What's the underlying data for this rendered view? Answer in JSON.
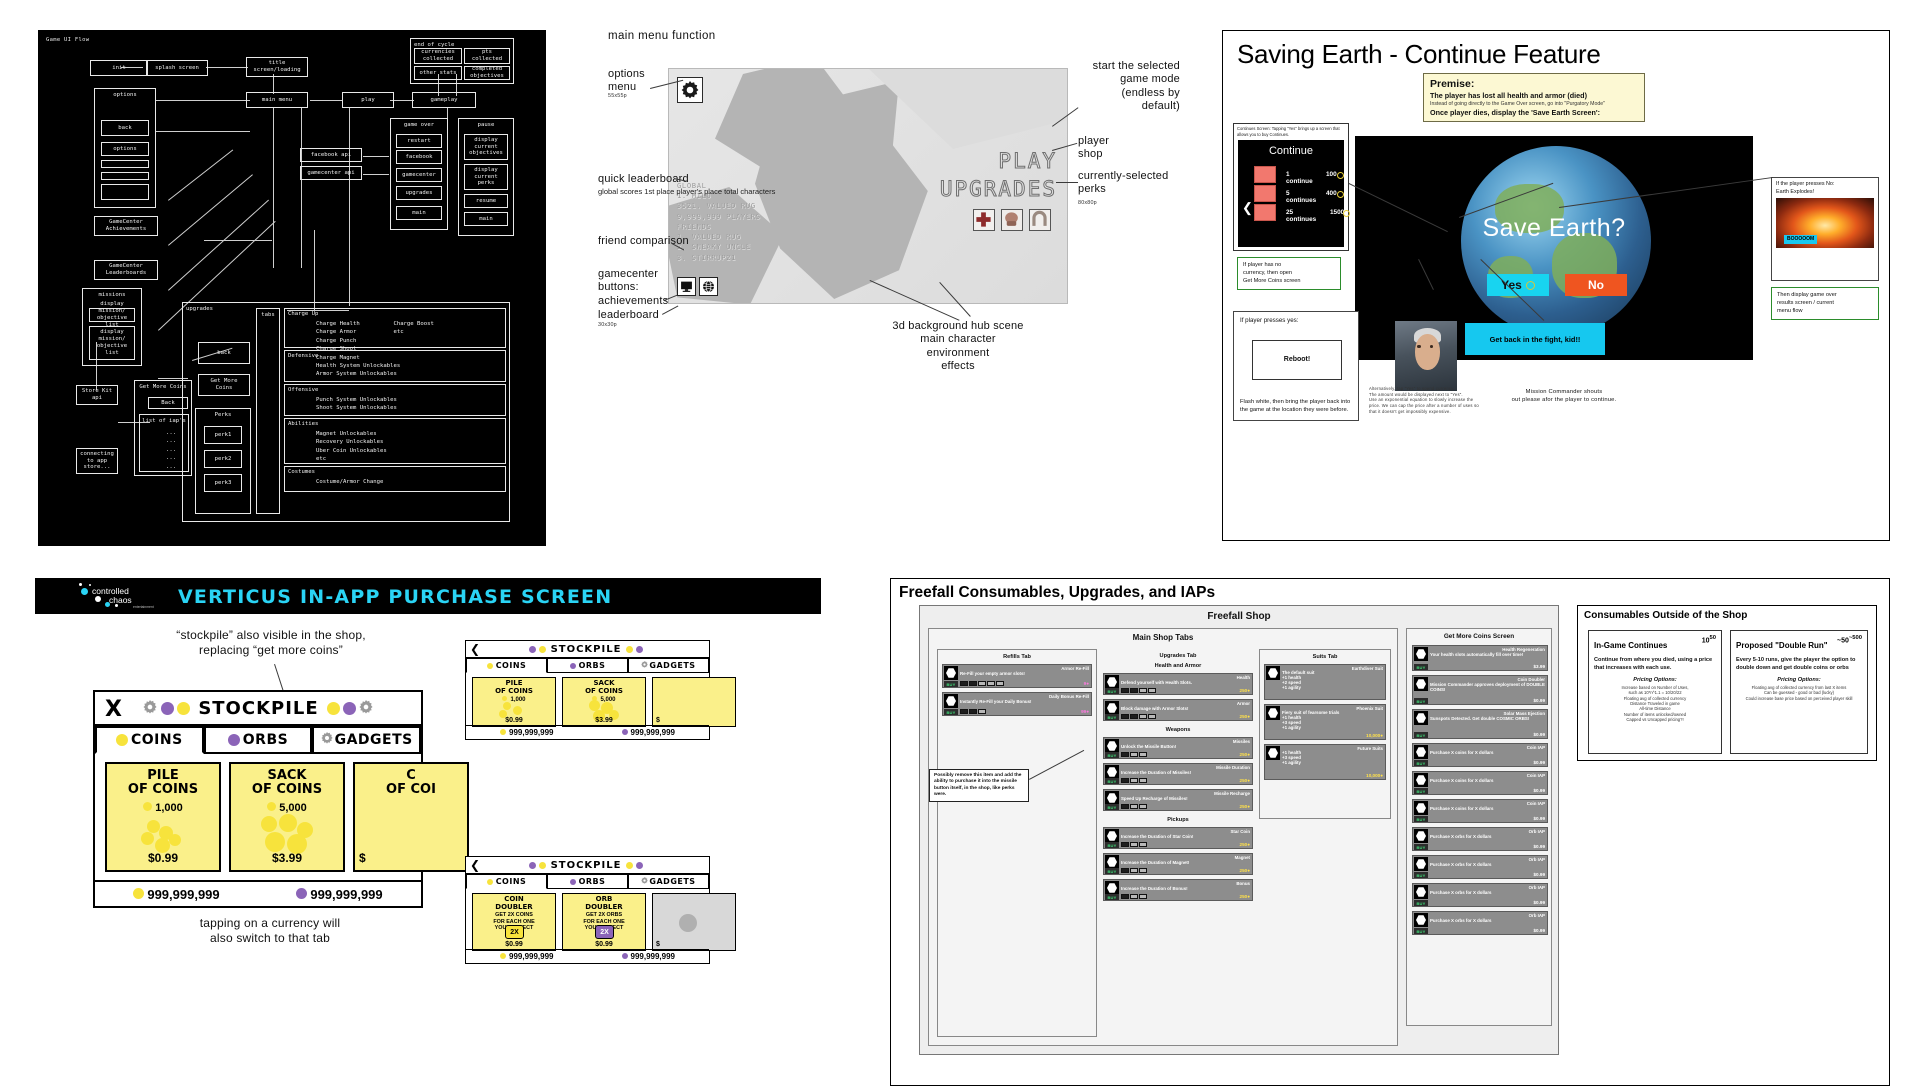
{
  "ui_flow": {
    "title": "Game UI Flow",
    "nodes": [
      {
        "label": "init"
      },
      {
        "label": "splash screen"
      },
      {
        "label": "title\nscreen/loading"
      },
      {
        "label": "main menu"
      },
      {
        "label": "play"
      },
      {
        "label": "gameplay"
      },
      {
        "label": "options"
      },
      {
        "label": "back"
      },
      {
        "label": "options"
      },
      {
        "label": "GameCenter\nAchievements"
      },
      {
        "label": "GameCenter\nLeaderboards"
      },
      {
        "label": "missions"
      },
      {
        "label": "display\nmission/\nobjective\nlist"
      },
      {
        "label": "Store Kit\napi"
      },
      {
        "label": "connecting\nto app\nstore..."
      },
      {
        "label": "Get More Coins"
      },
      {
        "label": "Back"
      },
      {
        "label": "list of iap's"
      },
      {
        "label": "facebook api"
      },
      {
        "label": "gamecenter api"
      },
      {
        "label": "game over"
      },
      {
        "label": "restart"
      },
      {
        "label": "facebook"
      },
      {
        "label": "gamecenter"
      },
      {
        "label": "upgrades"
      },
      {
        "label": "main"
      },
      {
        "label": "pause"
      },
      {
        "label": "display\ncurrent\nobjectives"
      },
      {
        "label": "display\ncurrent\nperks"
      },
      {
        "label": "resume"
      },
      {
        "label": "main"
      },
      {
        "label": "end of cycle"
      },
      {
        "label": "currencies\ncollected"
      },
      {
        "label": "pts\ncollected"
      },
      {
        "label": "other stats"
      },
      {
        "label": "completed\nobjectives"
      },
      {
        "label": "upgrades"
      },
      {
        "label": "back"
      },
      {
        "label": "Get More Coins"
      },
      {
        "label": "Perks"
      },
      {
        "label": "perk1"
      },
      {
        "label": "perk2"
      },
      {
        "label": "perk3"
      },
      {
        "label": "tabs"
      }
    ],
    "upgrade_sections": [
      {
        "heading": "Charge Up",
        "items": [
          "Charge Health          Charge Boost",
          "Charge Armor           etc",
          "Charge Punch",
          "Charge Shoot",
          "Charge Magnet"
        ]
      },
      {
        "heading": "Defensive",
        "items": [
          "Health System Unlockables",
          "Armor System Unlockables"
        ]
      },
      {
        "heading": "Offensive",
        "items": [
          "Punch System Unlockables",
          "Shoot System Unlockables"
        ]
      },
      {
        "heading": "Abilities",
        "items": [
          "Magnet Unlockables",
          "Recovery Unlockables",
          "Uber Coin Unlockables",
          "etc"
        ]
      },
      {
        "heading": "Costumes",
        "items": [
          "Costume/Armor Change"
        ]
      }
    ]
  },
  "main_menu": {
    "heading": "main menu function",
    "annotations": {
      "options_menu": "options\nmenu",
      "options_menu_size": "55x55p",
      "quick_leaderboard": "quick leaderboard",
      "quick_leaderboard_details": [
        "global scores",
        "1st place",
        "player's place",
        "total characters"
      ],
      "friend_comparison": "friend comparison",
      "gamecenter_buttons": "gamecenter\nbuttons:",
      "achievements": "achievements",
      "leaderboard": "leaderboard",
      "gc_size": "30x30p",
      "start_mode": "start the selected\ngame mode\n(endless by\ndefault)",
      "player_shop": "player shop",
      "selected_perks": "currently-selected\nperks",
      "perks_size": "80x80p",
      "background_note": "3d background hub scene\nmain character\nenvironment\neffects"
    },
    "leaderboard_lines": [
      "GLOBAL",
      "1. MILO",
      "3521. VALUED RUG",
      "9,999,999 PLAYERS",
      "FRIENDS",
      "1. VALUED RUG",
      "2. SNEAKY UNCLE",
      "3. STIRRUP21"
    ],
    "big_words": [
      "PLAY",
      "UPGRADES"
    ],
    "perk_icons": [
      "health-cross-icon",
      "boxing-glove-icon",
      "magnet-icon"
    ]
  },
  "saving_earth": {
    "title": "Saving Earth - Continue Feature",
    "premise": {
      "heading": "Premise:",
      "line1": "The player has lost all health and armor (died)",
      "line2": "Instead of going directly to the Game Over screen, go into \"Purgatory Mode\"",
      "line3": "Once player dies, display the 'Save Earth Screen':"
    },
    "continue_caption": "Continues Screen: Tapping \"Yes\" brings up a screen that allows you to buy Continues.",
    "continue_title": "Continue",
    "continue_options": [
      {
        "label": "1 continue",
        "price": "100"
      },
      {
        "label": "5 continues",
        "price": "400"
      },
      {
        "label": "25 continues",
        "price": "1500"
      }
    ],
    "no_currency_note": "If player has no\ncurrency, then open\nGet More Coins screen",
    "save_prompt": "Save Earth?",
    "yes_label": "Yes",
    "no_label": "No",
    "yes_note": "If player presses yes:",
    "yes_body": "Flash white, then bring the player back into the game at the location they were before.",
    "reboot_label": "Reboot!",
    "no_note": "If the player presses No:\nEarth Explodes!",
    "boom_label": "BOOOOOM",
    "game_over_note": "Then display game over\nresults screen / current\nmenu flow",
    "cyan_msg": "Get back in the fight, kid!!",
    "commander_note": "Mission Commander shouts\nout please afor the player to continue.",
    "currency_note": "Alternatively, tap \"Yes\" to spend currency.\nThe amount would be displayed next to \"Yes\".\nUse an exponential equation to slowly increase the price. We can cap the price after a number of uses so that it doesn't get impossibly expensive."
  },
  "iap": {
    "banner_title": "VERTICUS IN-APP PURCHASE SCREEN",
    "logo": {
      "line1": "controlled",
      "line2": "chaos",
      "line3": "entertainment"
    },
    "note_top": "“stockpile” also visible in the shop,\nreplacing “get more coins”",
    "note_bottom": "tapping on a currency will\nalso switch to that tab",
    "main_screen": {
      "close_label": "X",
      "title": "STOCKPILE",
      "tabs": [
        "COINS",
        "ORBS",
        "GADGETS"
      ],
      "active_tab": "COINS",
      "cards": [
        {
          "name": "PILE\nOF COINS",
          "qty": "1,000",
          "price": "$0.99"
        },
        {
          "name": "SACK\nOF COINS",
          "qty": "5,000",
          "price": "$3.99"
        },
        {
          "name": "C\nOF COI",
          "qty": "",
          "price": "$"
        }
      ],
      "footer": [
        {
          "value": "999,999,999",
          "type": "coin"
        },
        {
          "value": "999,999,999",
          "type": "orb"
        }
      ]
    },
    "small_screen_1": {
      "title": "STOCKPILE",
      "tabs": [
        "COINS",
        "ORBS",
        "GADGETS"
      ],
      "cards": [
        {
          "name": "PILE\nOF COINS",
          "qty": "1,000",
          "price": "$0.99"
        },
        {
          "name": "SACK\nOF COINS",
          "qty": "5,000",
          "price": "$3.99"
        },
        {
          "name": "",
          "qty": "",
          "price": "$"
        }
      ],
      "footer": [
        {
          "value": "999,999,999",
          "type": "coin"
        },
        {
          "value": "999,999,999",
          "type": "orb"
        }
      ]
    },
    "small_screen_2": {
      "title": "STOCKPILE",
      "tabs": [
        "COINS",
        "ORBS",
        "GADGETS"
      ],
      "cards": [
        {
          "name": "COIN\nDOUBLER",
          "desc": "GET 2X COINS\nFOR EACH ONE\nYOU COLLECT",
          "badge": "2X",
          "price": "$0.99"
        },
        {
          "name": "ORB\nDOUBLER",
          "desc": "GET 2X ORBS\nFOR EACH ONE\nYOU COLLECT",
          "badge": "2X",
          "price": "$0.99"
        },
        {
          "name": "",
          "desc": "",
          "badge": "",
          "price": "$"
        }
      ],
      "footer": [
        {
          "value": "999,999,999",
          "type": "coin"
        },
        {
          "value": "999,999,999",
          "type": "orb"
        }
      ]
    }
  },
  "freefall": {
    "title": "Freefall Consumables, Upgrades, and IAPs",
    "shop_title": "Freefall Shop",
    "main_tabs_label": "Main Shop Tabs",
    "columns": [
      {
        "label": "Refills Tab",
        "items": [
          {
            "name": "Armor Re-Fill",
            "desc": "Re-Fill your empty armor slots!",
            "price": "9",
            "currency": "orb",
            "pips": 5,
            "on": 2
          },
          {
            "name": "Daily Bonus Re-Fill",
            "desc": "Instantly Re-Fill your Daily Bonus!",
            "price": "99",
            "currency": "orb",
            "pips": 3,
            "on": 1
          }
        ]
      },
      {
        "label": "Upgrades Tab",
        "groups": [
          {
            "heading": "Health and Armor",
            "items": [
              {
                "name": "Health",
                "desc": "Defend yourself with Health Slots.",
                "price": "250",
                "currency": "coin"
              },
              {
                "name": "Armor",
                "desc": "Block damage with Armor Slots!",
                "price": "250",
                "currency": "coin"
              }
            ]
          },
          {
            "heading": "Weapons",
            "items": [
              {
                "name": "Missiles",
                "desc": "Unlock the Missile Button!",
                "price": "250",
                "currency": "coin"
              },
              {
                "name": "Missile Duration",
                "desc": "Increase the Duration of Missiles!",
                "price": "250",
                "currency": "coin"
              },
              {
                "name": "Missile Recharge",
                "desc": "Speed Up Recharge of Missiles!",
                "price": "250",
                "currency": "coin"
              }
            ]
          },
          {
            "heading": "Pickups",
            "items": [
              {
                "name": "Star Coin",
                "desc": "Increase the Duration of Star Coin!",
                "price": "250",
                "currency": "coin"
              },
              {
                "name": "Magnet",
                "desc": "Increase the Duration of Magnet!",
                "price": "250",
                "currency": "coin"
              },
              {
                "name": "Bonus",
                "desc": "Increase the Duration of Bonus!",
                "price": "250",
                "currency": "coin"
              }
            ]
          }
        ]
      },
      {
        "label": "Suits Tab",
        "items": [
          {
            "name": "Earthdiver Suit",
            "desc": "The default suit\n+1 health\n+2 speed\n+1 agility",
            "price": "",
            "currency": ""
          },
          {
            "name": "Phoenix Suit",
            "desc": "Fiery suit of fearsome trials\n+1 health\n+3 speed\n+1 agility",
            "price": "10,000",
            "currency": "coin"
          },
          {
            "name": "Future Suits",
            "desc": "+1 health\n+3 speed\n+1 agility",
            "price": "10,000",
            "currency": "coin"
          }
        ]
      }
    ],
    "get_more_coins": {
      "label": "Get More Coins Screen",
      "items": [
        {
          "name": "Health Regeneration",
          "desc": "Your health slots automatically fill over time!",
          "price": "$3.99"
        },
        {
          "name": "Coin Doubler",
          "desc": "Mission Commander approves deployment of DOUBLE COINS!",
          "price": "$0.99"
        },
        {
          "name": "Solar Mass Ejection",
          "desc": "Sunspots Detected. Get double COSMIC ORBS!",
          "price": "$0.99"
        },
        {
          "name": "Coin IAP",
          "desc": "Purchase X coins for X dollars",
          "price": "$0.99"
        },
        {
          "name": "Coin IAP",
          "desc": "Purchase X coins for X dollars",
          "price": "$0.99"
        },
        {
          "name": "Coin IAP",
          "desc": "Purchase X coins for X dollars",
          "price": "$0.99"
        },
        {
          "name": "Orb IAP",
          "desc": "Purchase X orbs for X dollars",
          "price": "$0.99"
        },
        {
          "name": "Orb IAP",
          "desc": "Purchase X orbs for X dollars",
          "price": "$0.99"
        },
        {
          "name": "Orb IAP",
          "desc": "Purchase X orbs for X dollars",
          "price": "$0.99"
        },
        {
          "name": "Orb IAP",
          "desc": "Purchase X orbs for X dollars",
          "price": "$0.99"
        }
      ]
    },
    "outside_shop": {
      "title": "Consumables Outside of the Shop",
      "cards": [
        {
          "heading": "In-Game Continues",
          "price": "10",
          "price_sup": "50",
          "desc": "Continue from where you died, using a price that increases with each use.",
          "pricing_heading": "Pricing Options:",
          "pricing": "Increase based on Number of Uses,\nsuch as 10*n^1.1 = 10/20/22\nFloating avg of collected currency\nDistance Traveled in game\nAll-time Distance\nNumber of items unlocked/owned\nCapped vs Uncapped pricing?!"
        },
        {
          "heading": "Proposed \"Double Run\"",
          "price": "~50",
          "price_sup": "~500",
          "desc": "Every 5-10 runs, give the player the option to double down and get double coins or orbs",
          "pricing_heading": "Pricing Options:",
          "pricing": "Floating avg of collected currency from last X items\nCan be guessed - good or bad (lucky)\nCould increase base price based on perceived player skill"
        }
      ]
    },
    "note_missile": "Possibly remove this item and add the ability to purchase it into the missile button itself, in the shop, like perks were."
  }
}
